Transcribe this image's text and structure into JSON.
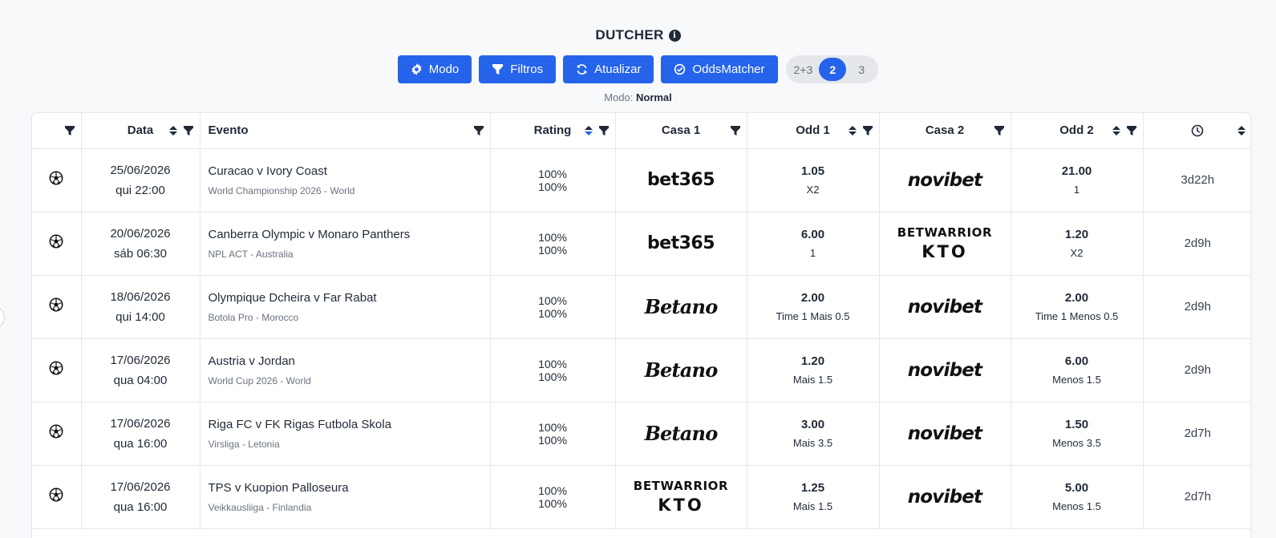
{
  "header": {
    "title": "DUTCHER"
  },
  "toolbar": {
    "modo_label": "Modo",
    "filtros_label": "Filtros",
    "atualizar_label": "Atualizar",
    "oddsmatcher_label": "OddsMatcher",
    "segments": [
      "2+3",
      "2",
      "3"
    ],
    "active_segment": "2"
  },
  "mode_line": {
    "label": "Modo:",
    "value": "Normal"
  },
  "table": {
    "columns": {
      "data": "Data",
      "evento": "Evento",
      "rating": "Rating",
      "casa1": "Casa 1",
      "odd1": "Odd 1",
      "casa2": "Casa 2",
      "odd2": "Odd 2"
    },
    "rows": [
      {
        "date": "25/06/2026",
        "time": "qui 22:00",
        "event": "Curacao v Ivory Coast",
        "league": "World Championship 2026 - World",
        "rating1": "100%",
        "rating2": "100%",
        "house1": "bet365",
        "odd1": "1.05",
        "market1": "X2",
        "house2": "novibet",
        "odd2": "21.00",
        "market2": "1",
        "remaining": "3d22h"
      },
      {
        "date": "20/06/2026",
        "time": "sáb 06:30",
        "event": "Canberra Olympic v Monaro Panthers",
        "league": "NPL ACT - Australia",
        "rating1": "100%",
        "rating2": "100%",
        "house1": "bet365",
        "odd1": "6.00",
        "market1": "1",
        "house2": "betwarrior",
        "odd2": "1.20",
        "market2": "X2",
        "remaining": "2d9h"
      },
      {
        "date": "18/06/2026",
        "time": "qui 14:00",
        "event": "Olympique Dcheira v Far Rabat",
        "league": "Botola Pro - Morocco",
        "rating1": "100%",
        "rating2": "100%",
        "house1": "betano",
        "odd1": "2.00",
        "market1": "Time 1 Mais 0.5",
        "house2": "novibet",
        "odd2": "2.00",
        "market2": "Time 1 Menos 0.5",
        "remaining": "2d9h"
      },
      {
        "date": "17/06/2026",
        "time": "qua 04:00",
        "event": "Austria v Jordan",
        "league": "World Cup 2026 - World",
        "rating1": "100%",
        "rating2": "100%",
        "house1": "betano",
        "odd1": "1.20",
        "market1": "Mais 1.5",
        "house2": "novibet",
        "odd2": "6.00",
        "market2": "Menos 1.5",
        "remaining": "2d9h"
      },
      {
        "date": "17/06/2026",
        "time": "qua 16:00",
        "event": "Riga FC v FK Rigas Futbola Skola",
        "league": "Virsliga - Letonia",
        "rating1": "100%",
        "rating2": "100%",
        "house1": "betano",
        "odd1": "3.00",
        "market1": "Mais 3.5",
        "house2": "novibet",
        "odd2": "1.50",
        "market2": "Menos 3.5",
        "remaining": "2d7h"
      },
      {
        "date": "17/06/2026",
        "time": "qua 16:00",
        "event": "TPS v Kuopion Palloseura",
        "league": "Veikkausliiga - Finlandia",
        "rating1": "100%",
        "rating2": "100%",
        "house1": "betwarrior",
        "odd1": "1.25",
        "market1": "Mais 1.5",
        "house2": "novibet",
        "odd2": "5.00",
        "market2": "Menos 1.5",
        "remaining": "2d7h"
      }
    ]
  },
  "logos": {
    "bet365": "bet365",
    "novibet": "novibet",
    "betano": "Betano",
    "betwarrior_l1": "BETWARRIOR",
    "betwarrior_l2": "KTO"
  },
  "colors": {
    "primary": "#2563eb",
    "segment_bg": "#e5e7eb",
    "border": "#e5e7eb"
  },
  "icons": [
    "info-icon",
    "gear-icon",
    "filter-icon",
    "refresh-icon",
    "oddsmatcher-icon",
    "sort-icon",
    "clock-icon",
    "soccer-ball-icon"
  ]
}
